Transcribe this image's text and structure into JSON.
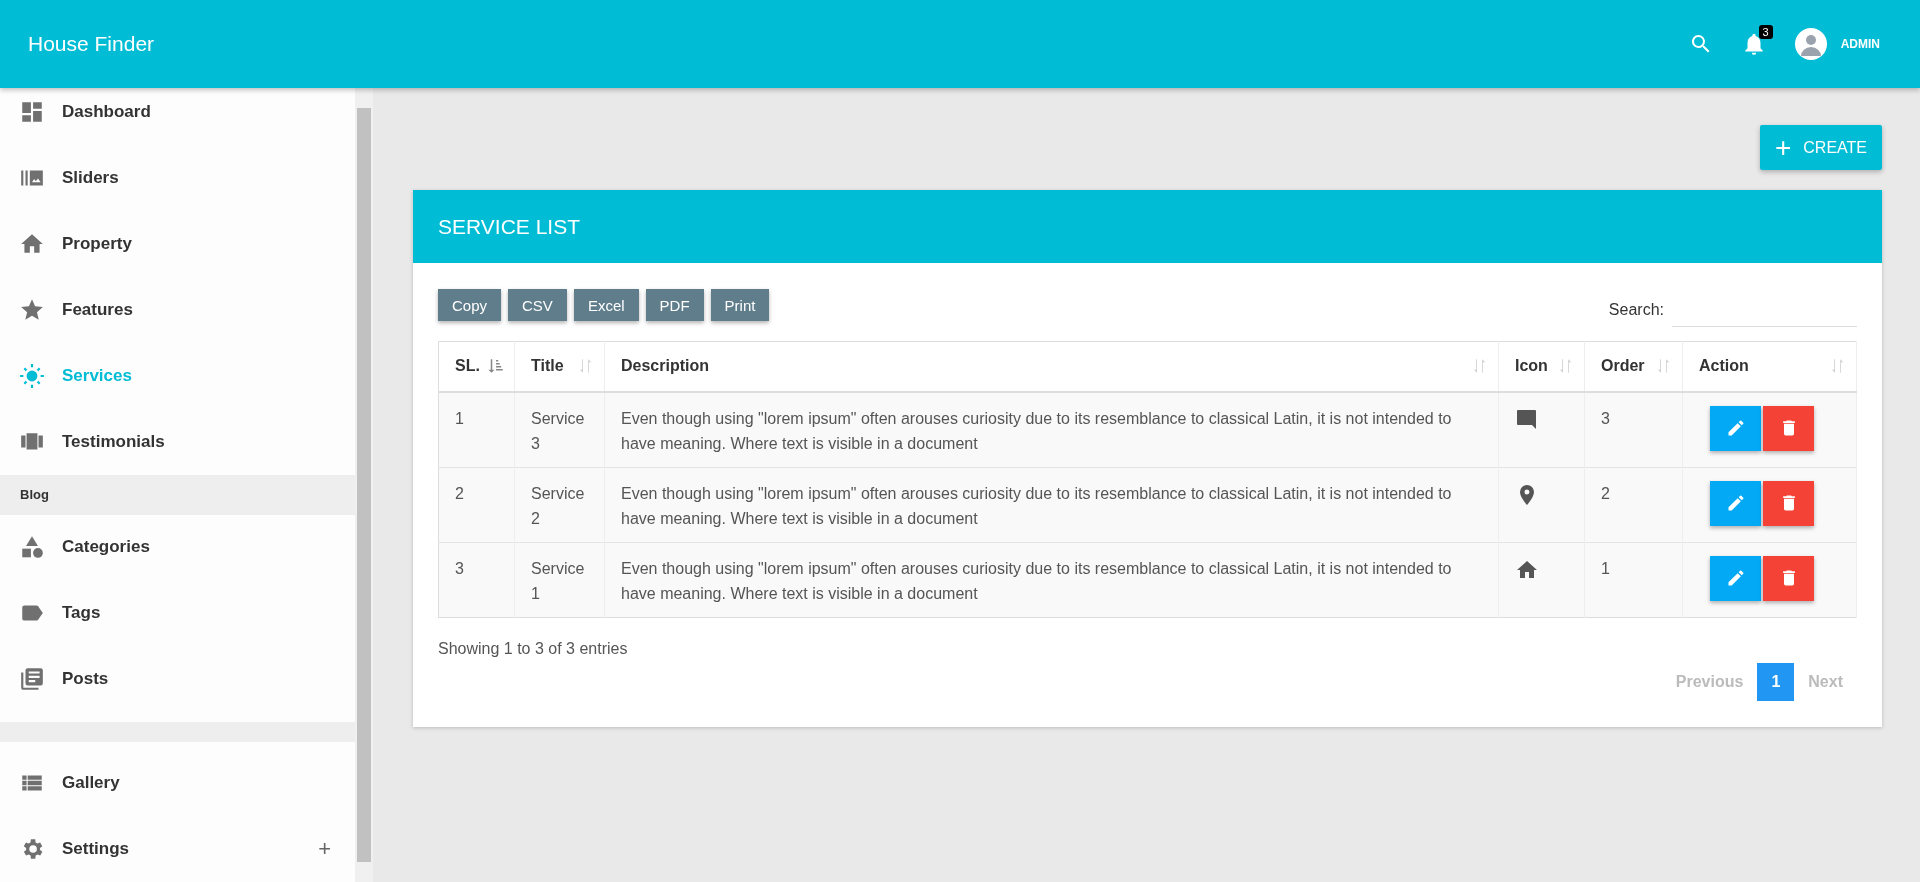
{
  "header": {
    "title": "House Finder",
    "notifications": "3",
    "user": "ADMIN"
  },
  "sidebar": {
    "items": [
      {
        "kind": "link",
        "label": "Dashboard",
        "selected": false
      },
      {
        "kind": "link",
        "label": "Sliders",
        "selected": false
      },
      {
        "kind": "link",
        "label": "Property",
        "selected": false
      },
      {
        "kind": "link",
        "label": "Features",
        "selected": false
      },
      {
        "kind": "link",
        "label": "Services",
        "selected": true
      },
      {
        "kind": "link",
        "label": "Testimonials",
        "selected": false
      },
      {
        "kind": "header",
        "label": "Blog"
      },
      {
        "kind": "link",
        "label": "Categories",
        "selected": false
      },
      {
        "kind": "link",
        "label": "Tags",
        "selected": false
      },
      {
        "kind": "link",
        "label": "Posts",
        "selected": false
      },
      {
        "kind": "divider"
      },
      {
        "kind": "link",
        "label": "Gallery",
        "selected": false
      },
      {
        "kind": "link",
        "label": "Settings",
        "selected": false,
        "expander": "+"
      }
    ]
  },
  "create_button": {
    "icon": "+",
    "label": "CREATE"
  },
  "card": {
    "title": "SERVICE LIST",
    "export_buttons": [
      "Copy",
      "CSV",
      "Excel",
      "PDF",
      "Print"
    ],
    "search": {
      "label": "Search:"
    },
    "table": {
      "columns": [
        {
          "label": "SL.",
          "sorted": true
        },
        {
          "label": "Title",
          "sorted": false
        },
        {
          "label": "Description",
          "sorted": false
        },
        {
          "label": "Icon",
          "sorted": false
        },
        {
          "label": "Order",
          "sorted": false
        },
        {
          "label": "Action",
          "sorted": false
        }
      ],
      "rows": [
        {
          "sl": "1",
          "title": "Service 3",
          "description": "Even though using \"lorem ipsum\" often arouses curiosity due to its resemblance to classical Latin, it is not intended to have meaning. Where text is visible in a document",
          "order": "3"
        },
        {
          "sl": "2",
          "title": "Service 2",
          "description": "Even though using \"lorem ipsum\" often arouses curiosity due to its resemblance to classical Latin, it is not intended to have meaning. Where text is visible in a document",
          "order": "2"
        },
        {
          "sl": "3",
          "title": "Service 1",
          "description": "Even though using \"lorem ipsum\" often arouses curiosity due to its resemblance to classical Latin, it is not intended to have meaning. Where text is visible in a document",
          "order": "1"
        }
      ]
    },
    "info": "Showing 1 to 3 of 3 entries",
    "pagination": [
      {
        "label": "Previous",
        "kind": "nav",
        "disabled": true
      },
      {
        "label": "1",
        "kind": "page",
        "selected": true
      },
      {
        "label": "Next",
        "kind": "nav",
        "disabled": true
      }
    ]
  }
}
